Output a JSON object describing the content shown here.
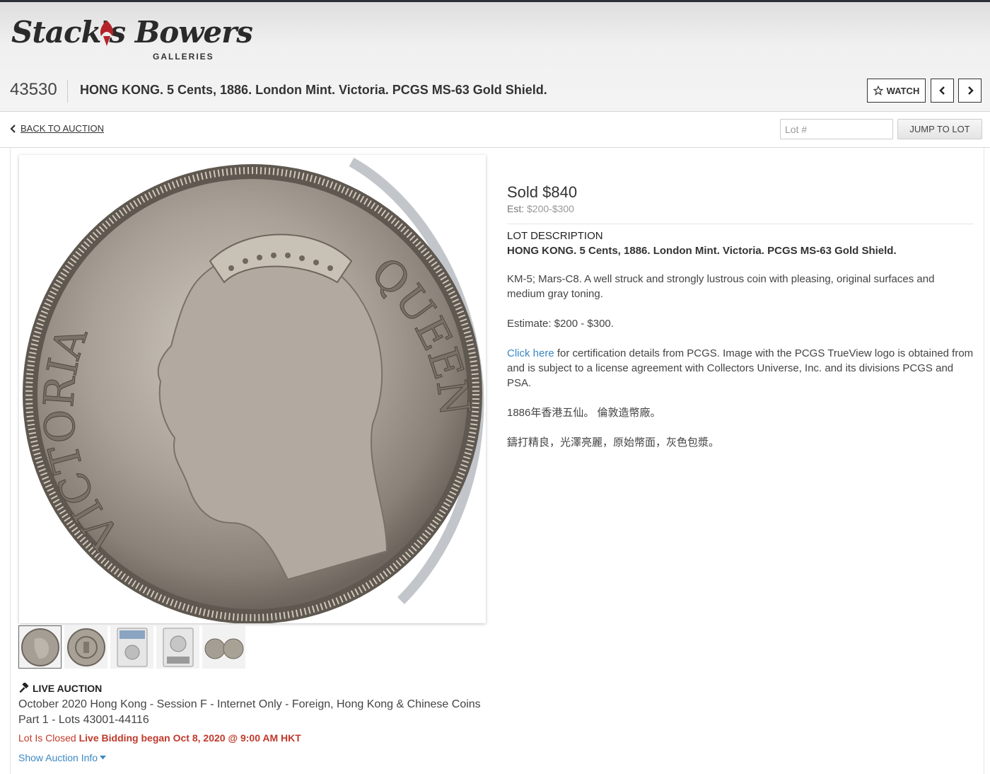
{
  "brand": {
    "name": "Stack's Bowers",
    "sub": "GALLERIES"
  },
  "lot": {
    "number": "43530",
    "title": "HONG KONG. 5 Cents, 1886. London Mint. Victoria. PCGS MS-63 Gold Shield."
  },
  "toolbar": {
    "watch_label": "WATCH"
  },
  "nav": {
    "back_label": "BACK TO AUCTION",
    "lot_placeholder": "Lot #",
    "jump_label": "JUMP TO LOT"
  },
  "images": {
    "coin_legend_left": "VICTORIA",
    "coin_legend_right": "QUEEN",
    "thumbnails": [
      "obverse",
      "reverse",
      "slab-front",
      "slab-back",
      "both-sides"
    ]
  },
  "auction": {
    "live_label": "LIVE AUCTION",
    "name": "October 2020 Hong Kong - Session F - Internet Only - Foreign, Hong Kong & Chinese Coins Part 1 - Lots 43001-44116",
    "closed_text": "Lot Is Closed",
    "began_text": "Live Bidding began Oct 8, 2020 @ 9:00 AM HKT",
    "show_info_label": "Show Auction Info"
  },
  "result": {
    "sold": "Sold $840",
    "est_label": "Est:",
    "est_value": "$200-$300"
  },
  "description": {
    "heading": "LOT DESCRIPTION",
    "title": "HONG KONG. 5 Cents, 1886. London Mint. Victoria. PCGS MS-63 Gold Shield.",
    "p1": "KM-5; Mars-C8. A well struck and strongly lustrous coin with pleasing, original surfaces and medium gray toning.",
    "p2": "Estimate: $200 - $300.",
    "p3_link": "Click here",
    "p3_rest": " for certification details from PCGS. Image with the PCGS TrueView logo is obtained from and is subject to a license agreement with Collectors Universe, Inc. and its divisions PCGS and PSA.",
    "p4": "1886年香港五仙。 倫敦造幣廠。",
    "p5": "鑄打精良，光澤亮麗，原始幣面，灰色包漿。"
  },
  "colors": {
    "link": "#3b88c3",
    "alert": "#c0392b"
  }
}
